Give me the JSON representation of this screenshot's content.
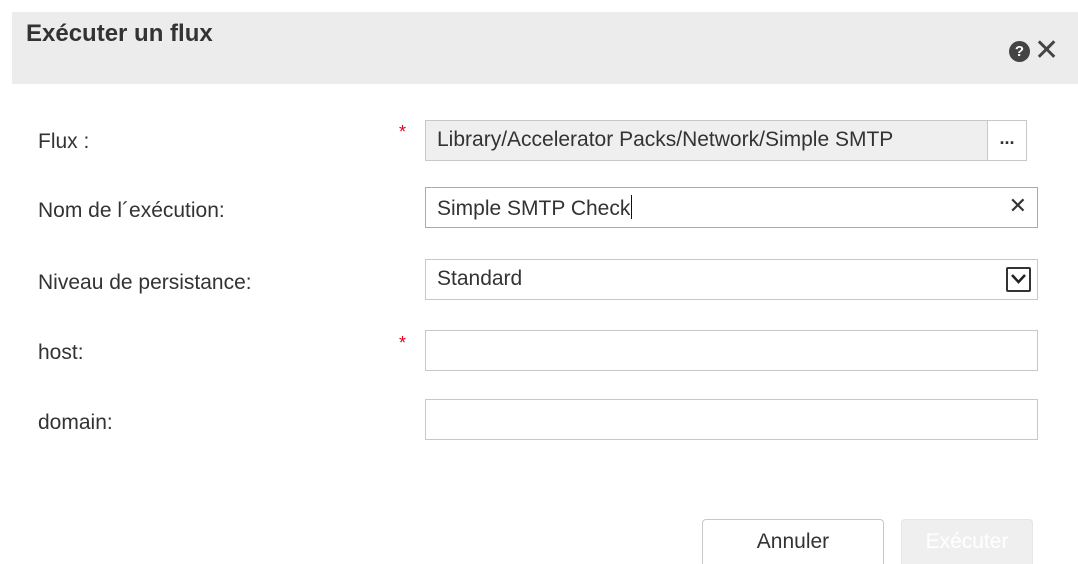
{
  "dialog": {
    "title": "Exécuter un flux",
    "help_icon": "question-circle-icon",
    "close_icon": "close-icon",
    "help_glyph": "?",
    "close_glyph": "✕"
  },
  "form": {
    "flow": {
      "label": "Flux :",
      "required": true,
      "required_mark": "*",
      "value": "Library/Accelerator Packs/Network/Simple SMTP",
      "browse_label": "..."
    },
    "run_name": {
      "label": "Nom de l´exécution:",
      "value": "Simple SMTP Check",
      "clear_glyph": "✕"
    },
    "persistence": {
      "label": "Niveau de persistance:",
      "selected": "Standard"
    },
    "host": {
      "label": "host:",
      "required": true,
      "required_mark": "*",
      "value": ""
    },
    "domain": {
      "label": "domain:",
      "value": ""
    }
  },
  "buttons": {
    "cancel": "Annuler",
    "run": "Exécuter"
  },
  "colors": {
    "header_bg": "#ececec",
    "required": "#e0001b",
    "focus_border": "#7ab8e6",
    "disabled_bg": "#efefef"
  }
}
